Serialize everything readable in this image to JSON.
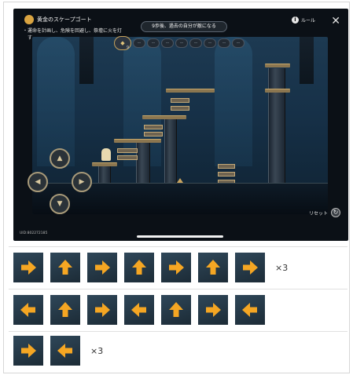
{
  "game": {
    "title": "黄金のスケープゴート",
    "hint": "運命を計画し、危険を回避し、祭壇に火を灯す",
    "banner": "9歩後、過去の自分が敵になる",
    "rule_label": "ルール",
    "reset_label": "リセット",
    "uid": "UID:802272185",
    "first_move_count": "9",
    "slot_placeholder": "--",
    "colors": {
      "gold": "#c6a25b",
      "stage": "#163047"
    }
  },
  "solution": {
    "rows": [
      {
        "arrows": [
          "right",
          "up",
          "right",
          "up",
          "right",
          "up",
          "right"
        ],
        "multiplier": "×3"
      },
      {
        "arrows": [
          "left",
          "up",
          "right",
          "left",
          "up",
          "right",
          "left"
        ],
        "multiplier": ""
      },
      {
        "arrows": [
          "right",
          "left"
        ],
        "multiplier": "×3"
      }
    ],
    "arrow_color": "#f5a623"
  }
}
